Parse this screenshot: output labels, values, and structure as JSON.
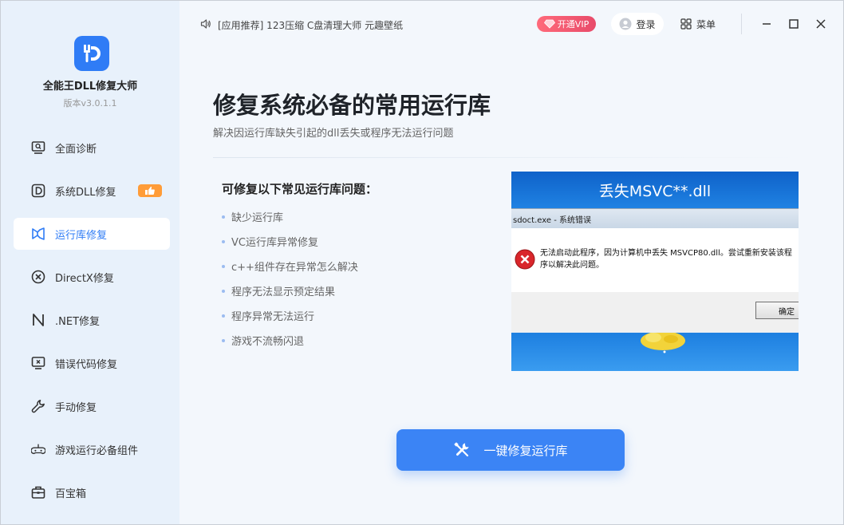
{
  "app": {
    "name": "全能王DLL修复大师",
    "version": "版本v3.0.1.1",
    "brand_color": "#2f7cf6"
  },
  "sidebar": {
    "items": [
      {
        "label": "全面诊断",
        "icon": "screen-search-icon",
        "active": false
      },
      {
        "label": "系统DLL修复",
        "icon": "dll-d-icon",
        "active": false,
        "badge": "thumbs-up-icon"
      },
      {
        "label": "运行库修复",
        "icon": "bowtie-runtime-icon",
        "active": true
      },
      {
        "label": "DirectX修复",
        "icon": "circle-x-icon",
        "active": false
      },
      {
        "label": ".NET修复",
        "icon": "net-n-icon",
        "active": false
      },
      {
        "label": "错误代码修复",
        "icon": "monitor-error-icon",
        "active": false
      },
      {
        "label": "手动修复",
        "icon": "wrench-icon",
        "active": false
      },
      {
        "label": "游戏运行必备组件",
        "icon": "gamepad-icon",
        "active": false
      },
      {
        "label": "百宝箱",
        "icon": "toolbox-icon",
        "active": false
      }
    ]
  },
  "topbar": {
    "news": "[应用推荐] 123压缩 C盘清理大师 元趣壁纸",
    "vip_label": "开通VIP",
    "login_label": "登录",
    "menu_label": "菜单"
  },
  "main": {
    "title": "修复系统必备的常用运行库",
    "subtitle": "解决因运行库缺失引起的dll丢失或程序无法运行问题",
    "issues_heading": "可修复以下常见运行库问题：",
    "issues": [
      "缺少运行库",
      "VC运行库异常修复",
      "c++组件存在异常怎么解决",
      "程序无法显示预定结果",
      "程序异常无法运行",
      "游戏不流畅闪退"
    ],
    "screenshot": {
      "banner": "丢失MSVC**.dll",
      "dialog_title": "sdoct.exe - 系统错误",
      "error_text": "无法启动此程序，因为计算机中丢失 MSVCP80.dll。尝试重新安装该程序以解决此问题。",
      "ok_label": "确定"
    },
    "cta_label": "一键修复运行库"
  }
}
